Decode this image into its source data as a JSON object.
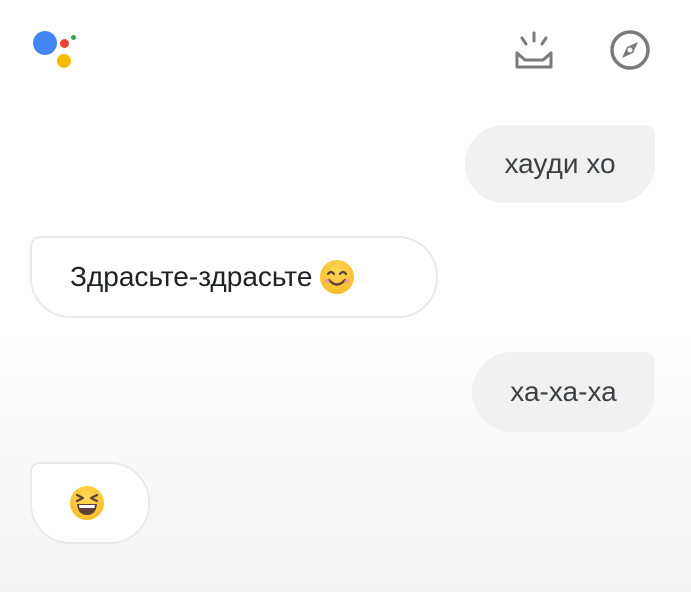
{
  "header": {
    "assistant_logo": {
      "icon": "google-assistant-logo",
      "colors": {
        "blue": "#4285F4",
        "red": "#EA4335",
        "yellow": "#FBBC05",
        "green": "#34A853"
      }
    },
    "updates_icon": "snapshot-tray-icon",
    "explore_icon": "compass-icon",
    "icon_color": "#7a7a7a"
  },
  "messages": [
    {
      "sender": "user",
      "text": "хауди хо"
    },
    {
      "sender": "assistant",
      "text": "Здрасьте-здрасьте",
      "emoji": "smiling-face-with-smiling-eyes"
    },
    {
      "sender": "user",
      "text": "ха-ха-ха"
    },
    {
      "sender": "assistant",
      "text": "",
      "emoji": "grinning-squinting-face"
    }
  ]
}
